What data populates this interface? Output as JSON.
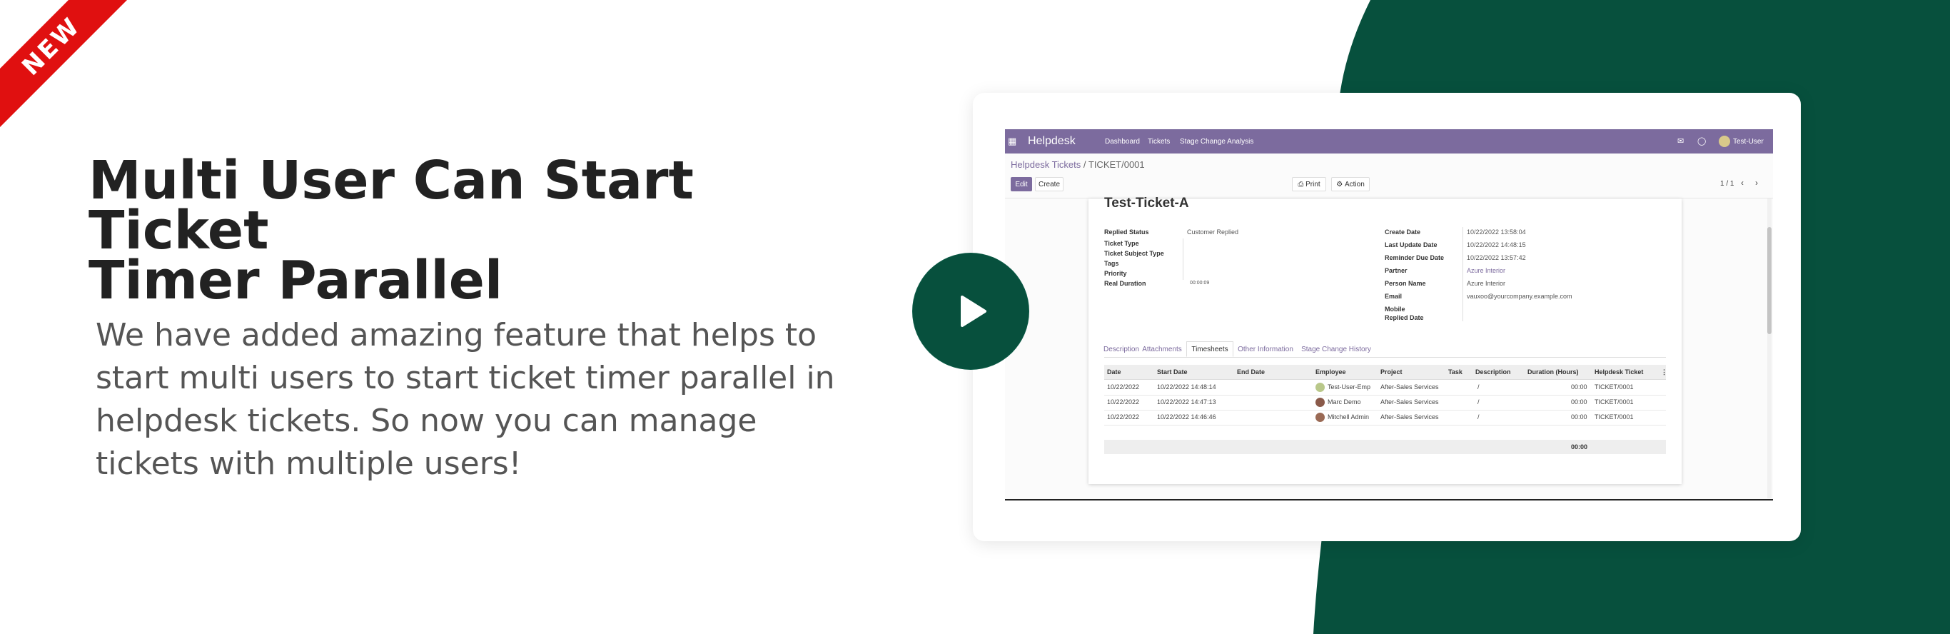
{
  "ribbon": {
    "text": "NEW",
    "color": "#e01010"
  },
  "headline": [
    "Multi User Can Start Ticket",
    "Timer Parallel"
  ],
  "description": [
    "We have added amazing feature that helps to",
    "start multi users to start ticket timer parallel in",
    "helpdesk tickets. So now you can manage",
    "tickets with multiple users!"
  ],
  "colors": {
    "accent_green": "#07503d",
    "odoo_purple": "#7c6b9e",
    "ribbon_red": "#e01010"
  },
  "play_button": {
    "icon": "play-icon"
  },
  "app": {
    "navbar": {
      "apps_icon": "grid-icon",
      "brand": "Helpdesk",
      "menu": [
        "Dashboard",
        "Tickets",
        "Stage Change Analysis"
      ],
      "icons": [
        "chat-icon",
        "clock-icon"
      ],
      "user": "Test-User"
    },
    "breadcrumb": {
      "parent": "Helpdesk Tickets",
      "separator": " / ",
      "current": "TICKET/0001"
    },
    "buttons": {
      "edit": "Edit",
      "create": "Create",
      "print": "Print",
      "action": "Action"
    },
    "pager": "1 / 1",
    "ticket": {
      "title": "Test-Ticket-A",
      "left_fields": [
        {
          "label": "Replied Status",
          "value": "Customer Replied"
        },
        {
          "label": "Ticket Type",
          "value": ""
        },
        {
          "label": "Ticket Subject Type",
          "value": ""
        },
        {
          "label": "Tags",
          "value": ""
        },
        {
          "label": "Priority",
          "value": ""
        },
        {
          "label": "Real Duration",
          "value": "00:00:09"
        }
      ],
      "right_fields": [
        {
          "label": "Create Date",
          "value": "10/22/2022 13:58:04"
        },
        {
          "label": "Last Update Date",
          "value": "10/22/2022 14:48:15"
        },
        {
          "label": "Reminder Due Date",
          "value": "10/22/2022 13:57:42"
        },
        {
          "label": "Partner",
          "value": "Azure Interior"
        },
        {
          "label": "Person Name",
          "value": "Azure Interior"
        },
        {
          "label": "Email",
          "value": "vauxoo@yourcompany.example.com"
        },
        {
          "label": "Mobile",
          "value": ""
        },
        {
          "label": "Replied Date",
          "value": ""
        }
      ]
    },
    "tabs": [
      "Description",
      "Attachments",
      "Timesheets",
      "Other Information",
      "Stage Change History"
    ],
    "active_tab": "Timesheets",
    "timesheet": {
      "columns": [
        "Date",
        "Start Date",
        "End Date",
        "Employee",
        "Project",
        "Task",
        "Description",
        "Duration (Hours)",
        "Helpdesk Ticket"
      ],
      "rows": [
        {
          "date": "10/22/2022",
          "start": "10/22/2022 14:48:14",
          "end": "",
          "employee": "Test-User-Emp",
          "project": "After-Sales Services",
          "task": "",
          "description": "/",
          "duration": "00:00",
          "ticket": "TICKET/0001"
        },
        {
          "date": "10/22/2022",
          "start": "10/22/2022 14:47:13",
          "end": "",
          "employee": "Marc Demo",
          "project": "After-Sales Services",
          "task": "",
          "description": "/",
          "duration": "00:00",
          "ticket": "TICKET/0001"
        },
        {
          "date": "10/22/2022",
          "start": "10/22/2022 14:46:46",
          "end": "",
          "employee": "Mitchell Admin",
          "project": "After-Sales Services",
          "task": "",
          "description": "/",
          "duration": "00:00",
          "ticket": "TICKET/0001"
        }
      ],
      "total_duration": "00:00"
    }
  }
}
